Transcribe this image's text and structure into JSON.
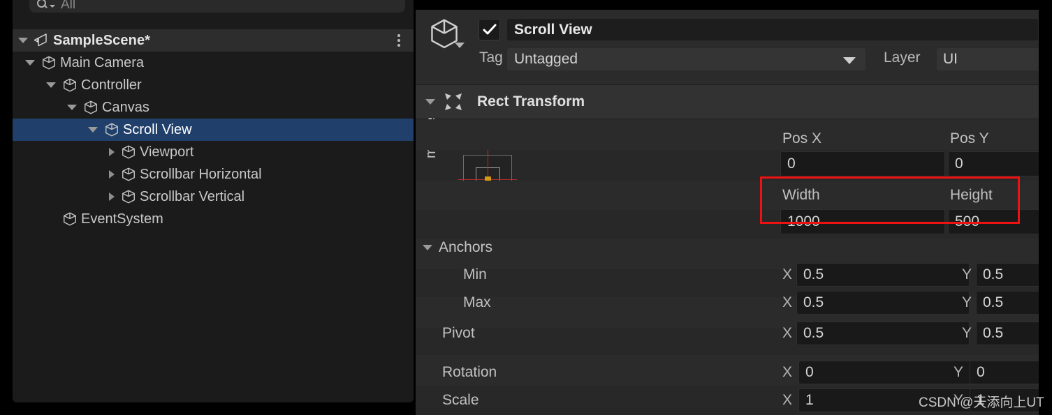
{
  "hierarchy": {
    "search": {
      "value": "All",
      "icon": "search-icon"
    },
    "scene": {
      "name": "SampleScene*",
      "menu_icon": "kebab-menu-icon"
    },
    "nodes": [
      {
        "label": "Main Camera",
        "depth": 1,
        "arrow": "down",
        "selected": false
      },
      {
        "label": "Controller",
        "depth": 2,
        "arrow": "down",
        "selected": false
      },
      {
        "label": "Canvas",
        "depth": 3,
        "arrow": "down",
        "selected": false
      },
      {
        "label": "Scroll View",
        "depth": 4,
        "arrow": "down",
        "selected": true
      },
      {
        "label": "Viewport",
        "depth": 5,
        "arrow": "right",
        "selected": false
      },
      {
        "label": "Scrollbar Horizontal",
        "depth": 5,
        "arrow": "right",
        "selected": false
      },
      {
        "label": "Scrollbar Vertical",
        "depth": 5,
        "arrow": "right",
        "selected": false
      },
      {
        "label": "EventSystem",
        "depth": 2,
        "arrow": "none",
        "selected": false
      }
    ]
  },
  "inspector": {
    "object_name": "Scroll View",
    "active": true,
    "tag": {
      "label": "Tag",
      "value": "Untagged"
    },
    "layer": {
      "label": "Layer",
      "value": "UI"
    },
    "component": {
      "title": "Rect Transform",
      "icon": "rect-transform-icon",
      "anchor_preset": {
        "horizontal": "center",
        "vertical": "middle"
      },
      "pos": {
        "x_label": "Pos X",
        "x_value": "0",
        "y_label": "Pos Y",
        "y_value": "0"
      },
      "size": {
        "width_label": "Width",
        "width_value": "1000",
        "height_label": "Height",
        "height_value": "500",
        "highlighted": true,
        "highlight_color": "#ee1111"
      },
      "anchors": {
        "label": "Anchors",
        "min": {
          "label": "Min",
          "x": "0.5",
          "y": "0.5"
        },
        "max": {
          "label": "Max",
          "x": "0.5",
          "y": "0.5"
        }
      },
      "pivot": {
        "label": "Pivot",
        "x": "0.5",
        "y": "0.5"
      },
      "rotation": {
        "label": "Rotation",
        "x": "0",
        "y": "0"
      },
      "scale": {
        "label": "Scale",
        "x": "1",
        "y": "1"
      },
      "axis_x": "X",
      "axis_y": "Y"
    }
  },
  "watermark": "CSDN @天添向上UT"
}
